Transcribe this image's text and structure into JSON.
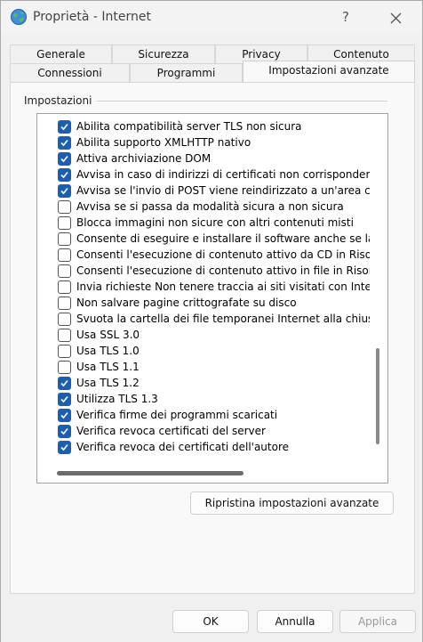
{
  "window": {
    "title": "Proprietà - Internet",
    "help": "?"
  },
  "tabs_row1": [
    {
      "label": "Generale"
    },
    {
      "label": "Sicurezza"
    },
    {
      "label": "Privacy"
    },
    {
      "label": "Contenuto"
    }
  ],
  "tabs_row2": [
    {
      "label": "Connessioni"
    },
    {
      "label": "Programmi"
    },
    {
      "label": "Impostazioni avanzate",
      "active": true
    }
  ],
  "settings": {
    "group_label": "Impostazioni",
    "items": [
      {
        "label": "Abilita compatibilità server TLS non sicura",
        "checked": true
      },
      {
        "label": "Abilita supporto XMLHTTP nativo",
        "checked": true
      },
      {
        "label": "Attiva archiviazione DOM",
        "checked": true
      },
      {
        "label": "Avvisa in caso di indirizzi di certificati non corrispondenti",
        "checked": true
      },
      {
        "label": "Avvisa se l'invio di POST viene reindirizzato a un'area che",
        "checked": true
      },
      {
        "label": "Avvisa se si passa da modalità sicura a non sicura",
        "checked": false
      },
      {
        "label": "Blocca immagini non sicure con altri contenuti misti",
        "checked": false
      },
      {
        "label": "Consente di eseguire e installare il software anche se la f",
        "checked": false
      },
      {
        "label": "Consenti l'esecuzione di contenuto attivo da CD in Risorse",
        "checked": false
      },
      {
        "label": "Consenti l'esecuzione di contenuto attivo in file in Risorse",
        "checked": false
      },
      {
        "label": "Invia richieste Non tenere traccia ai siti visitati con Interne",
        "checked": false
      },
      {
        "label": "Non salvare pagine crittografate su disco",
        "checked": false
      },
      {
        "label": "Svuota la cartella dei file temporanei Internet alla chiusur",
        "checked": false
      },
      {
        "label": "Usa SSL 3.0",
        "checked": false
      },
      {
        "label": "Usa TLS 1.0",
        "checked": false
      },
      {
        "label": "Usa TLS 1.1",
        "checked": false
      },
      {
        "label": "Usa TLS 1.2",
        "checked": true
      },
      {
        "label": "Utilizza TLS 1.3",
        "checked": true
      },
      {
        "label": "Verifica firme dei programmi scaricati",
        "checked": true
      },
      {
        "label": "Verifica revoca certificati del server",
        "checked": true
      },
      {
        "label": "Verifica revoca dei certificati dell'autore",
        "checked": true
      }
    ],
    "restore_button": "Ripristina impostazioni avanzate"
  },
  "footer": {
    "ok": "OK",
    "cancel": "Annulla",
    "apply": "Applica",
    "apply_disabled": true
  },
  "colors": {
    "checkbox_checked": "#1a5fb4",
    "panel_background": "#f9f9f9",
    "window_background": "#f0f0f0"
  },
  "icons": {
    "title": "internet-globe-icon",
    "close": "close-icon",
    "check": "checkmark-icon"
  }
}
